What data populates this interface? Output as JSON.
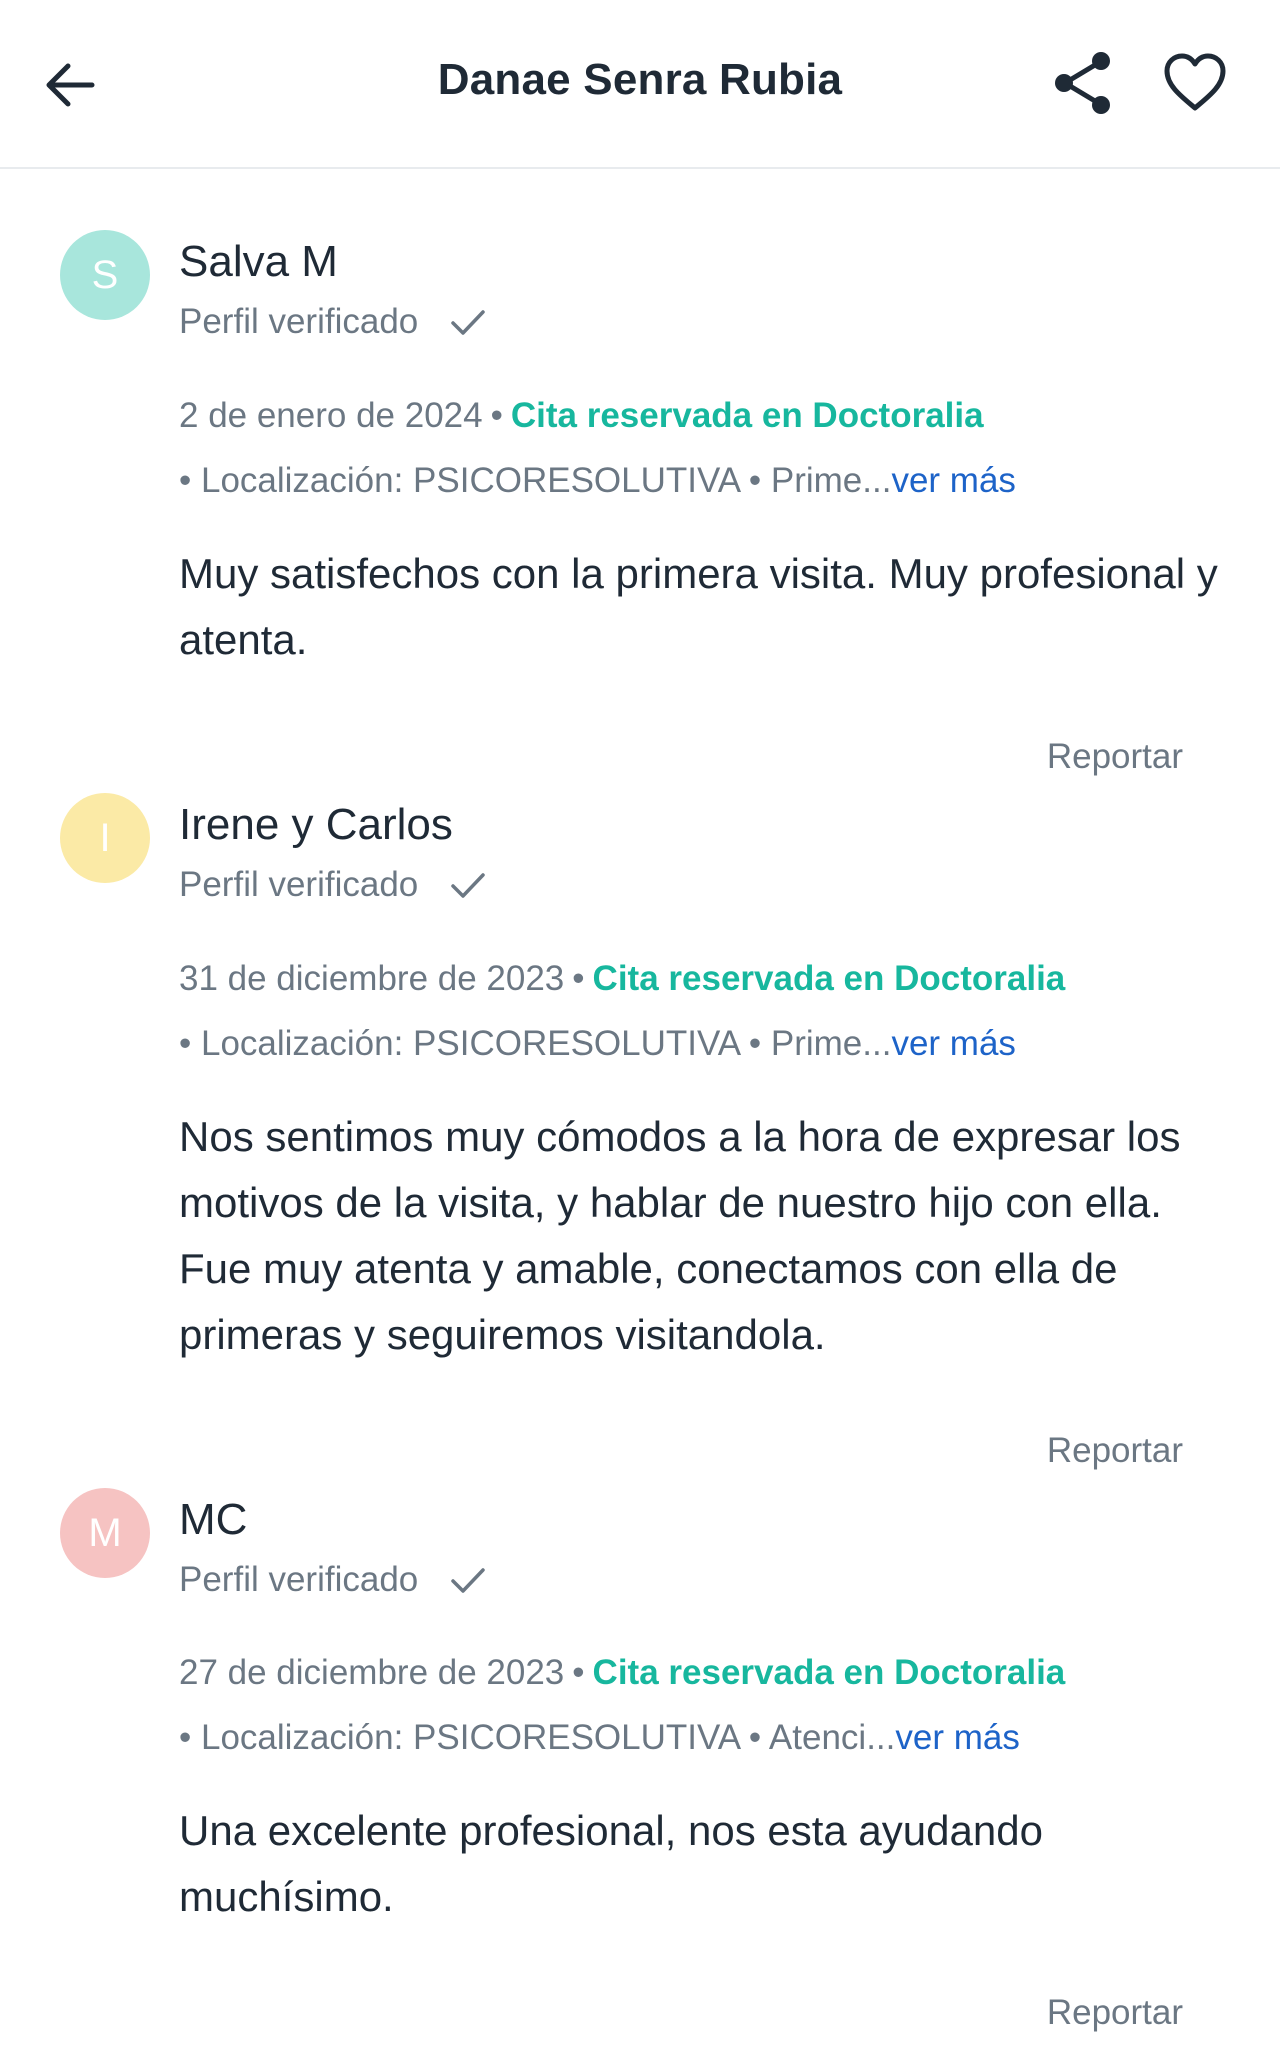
{
  "header": {
    "title": "Danae Senra Rubia",
    "back_icon": "arrow-left-icon",
    "share_icon": "share-icon",
    "favorite_icon": "heart-icon"
  },
  "reviews": [
    {
      "initial": "S",
      "avatar_color": "#a8e6dc",
      "author": "Salva M",
      "verified": "Perfil verificado",
      "date": "2 de enero de 2024",
      "booked": "Cita reservada en Doctoralia",
      "location": "• Localización: PSICORESOLUTIVA • Prime...",
      "more": "ver más",
      "text": "Muy satisfechos con la primera visita. Muy profesional y atenta.",
      "report": "Reportar"
    },
    {
      "initial": "I",
      "avatar_color": "#fbeaa6",
      "author": "Irene y Carlos",
      "verified": "Perfil verificado",
      "date": "31 de diciembre de 2023",
      "booked": "Cita reservada en Doctoralia",
      "location": "• Localización: PSICORESOLUTIVA • Prime...",
      "more": "ver más",
      "text": "Nos sentimos muy cómodos a la hora de expresar los motivos de la visita, y hablar de nuestro hijo con ella. Fue muy atenta y amable, conectamos con ella de primeras y seguiremos visitandola.",
      "report": "Reportar"
    },
    {
      "initial": "M",
      "avatar_color": "#f6c3c2",
      "author": "MC",
      "verified": "Perfil verificado",
      "date": "27 de diciembre de 2023",
      "booked": "Cita reservada en Doctoralia",
      "location": "• Localización: PSICORESOLUTIVA • Atenci...",
      "more": "ver más",
      "text": "Una excelente profesional, nos esta ayudando muchísimo.",
      "report": "Reportar"
    }
  ],
  "colors": {
    "accent_green": "#17b79e",
    "link_blue": "#1d63c8",
    "muted_text": "#6b7783",
    "primary_text": "#1f2a36"
  }
}
